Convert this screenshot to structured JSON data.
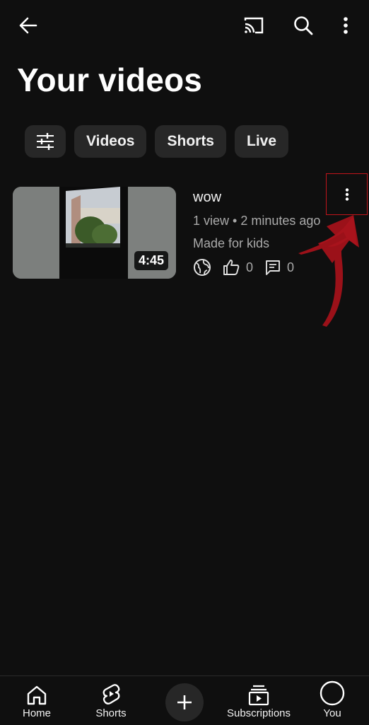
{
  "header": {
    "title": "Your videos",
    "icons": [
      "back-arrow-icon",
      "cast-icon",
      "search-icon",
      "more-vertical-icon"
    ]
  },
  "chips": [
    {
      "label": "",
      "icon": "filter-sliders-icon"
    },
    {
      "label": "Videos"
    },
    {
      "label": "Shorts"
    },
    {
      "label": "Live"
    }
  ],
  "video": {
    "title": "wow",
    "meta": "1 view • 2 minutes ago",
    "audience": "Made for kids",
    "duration": "4:45",
    "visibility_icon": "globe-icon",
    "likes": "0",
    "comments": "0"
  },
  "annotation": {
    "color": "#9b1119",
    "target": "video-more-button"
  },
  "bottom_nav": {
    "home": "Home",
    "shorts": "Shorts",
    "subscriptions": "Subscriptions",
    "you": "You"
  }
}
